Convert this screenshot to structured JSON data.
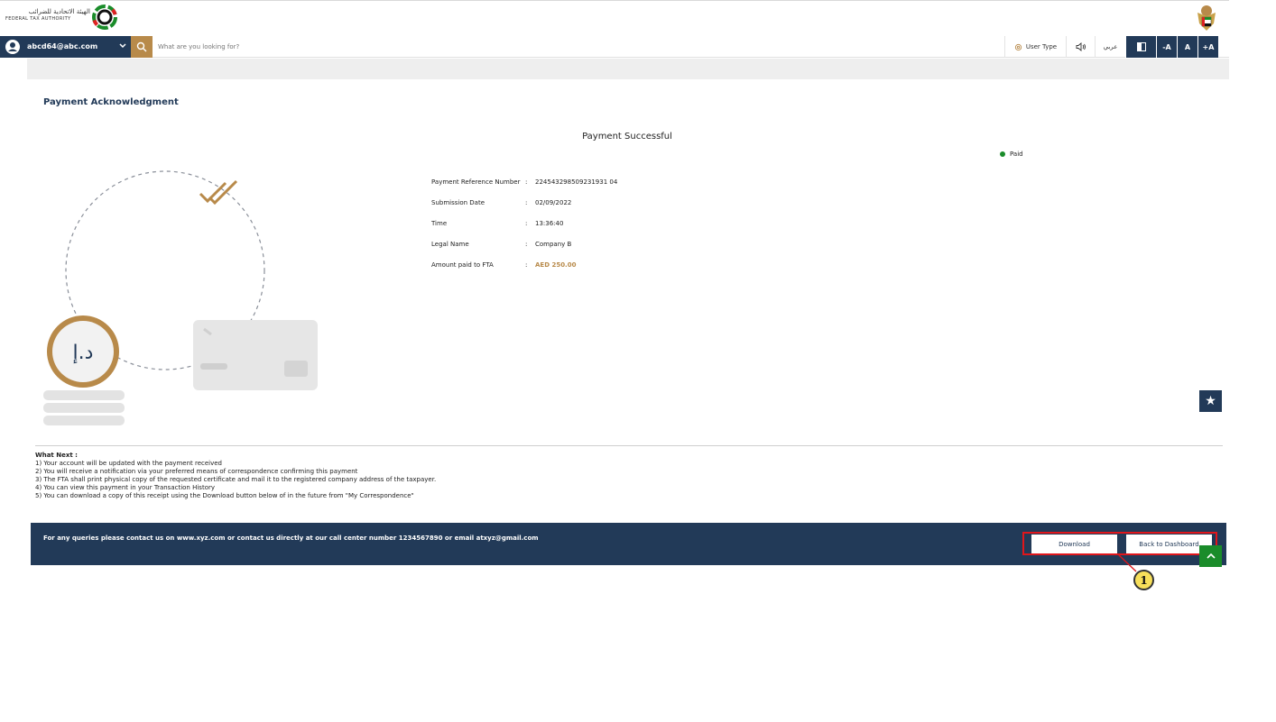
{
  "header": {
    "logo_arabic": "الهيئة الاتحادية للضرائب",
    "logo_english": "FEDERAL TAX AUTHORITY"
  },
  "navbar": {
    "user_email": "abcd64@abc.com",
    "search_placeholder": "What are you looking for?",
    "user_type_label": "User Type",
    "arabic_label": "عربي",
    "font_decrease": "-A",
    "font_normal": "A",
    "font_increase": "+A"
  },
  "main": {
    "page_title": "Payment Acknowledgment",
    "success_title": "Payment Successful",
    "status_label": "Paid",
    "details": [
      {
        "label": "Payment Reference Number",
        "value": "224543298509231931 04"
      },
      {
        "label": "Submission Date",
        "value": "02/09/2022"
      },
      {
        "label": "Time",
        "value": "13:36:40"
      },
      {
        "label": "Legal Name",
        "value": "Company B"
      },
      {
        "label": "Amount paid to FTA",
        "value": "AED 250.00"
      }
    ],
    "coin_symbol": "د.إ"
  },
  "what_next": {
    "title": "What Next :",
    "items": [
      "1) Your account will be updated with the payment received",
      "2) You will receive a notification via your preferred means of correspondence confirming this payment",
      "3) The FTA shall print physical copy of the requested certificate and mail it to the registered company address of the taxpayer.",
      "4) You can view this payment in your Transaction History",
      "5) You can download a copy of this receipt using the Download button below of in the future from \"My Correspondence\""
    ]
  },
  "footer": {
    "contact_text": "For any queries please contact us on www.xyz.com or contact us directly at our call center number 1234567890 or email atxyz@gmail.com",
    "download_label": "Download",
    "dashboard_label": "Back to Dashboard"
  },
  "annotation": {
    "callout_number": "1"
  },
  "colors": {
    "navy": "#223a58",
    "gold": "#b88a4a",
    "paid_green": "#1a8c2a",
    "highlight_red": "#e0161b"
  }
}
